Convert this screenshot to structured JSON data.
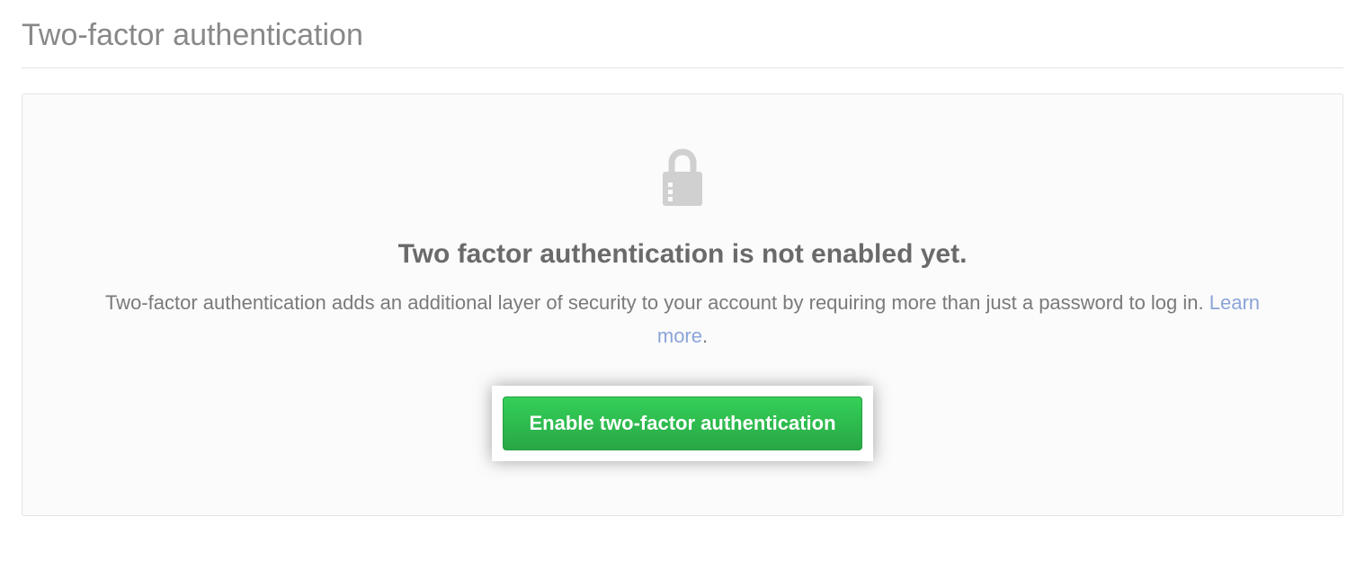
{
  "header": {
    "title": "Two-factor authentication"
  },
  "panel": {
    "heading": "Two factor authentication is not enabled yet.",
    "description_part1": "Two-factor authentication adds an additional layer of security to your account by requiring more than just a password to log in. ",
    "learn_more_label": "Learn more",
    "description_period": ".",
    "button_label": "Enable two-factor authentication"
  }
}
